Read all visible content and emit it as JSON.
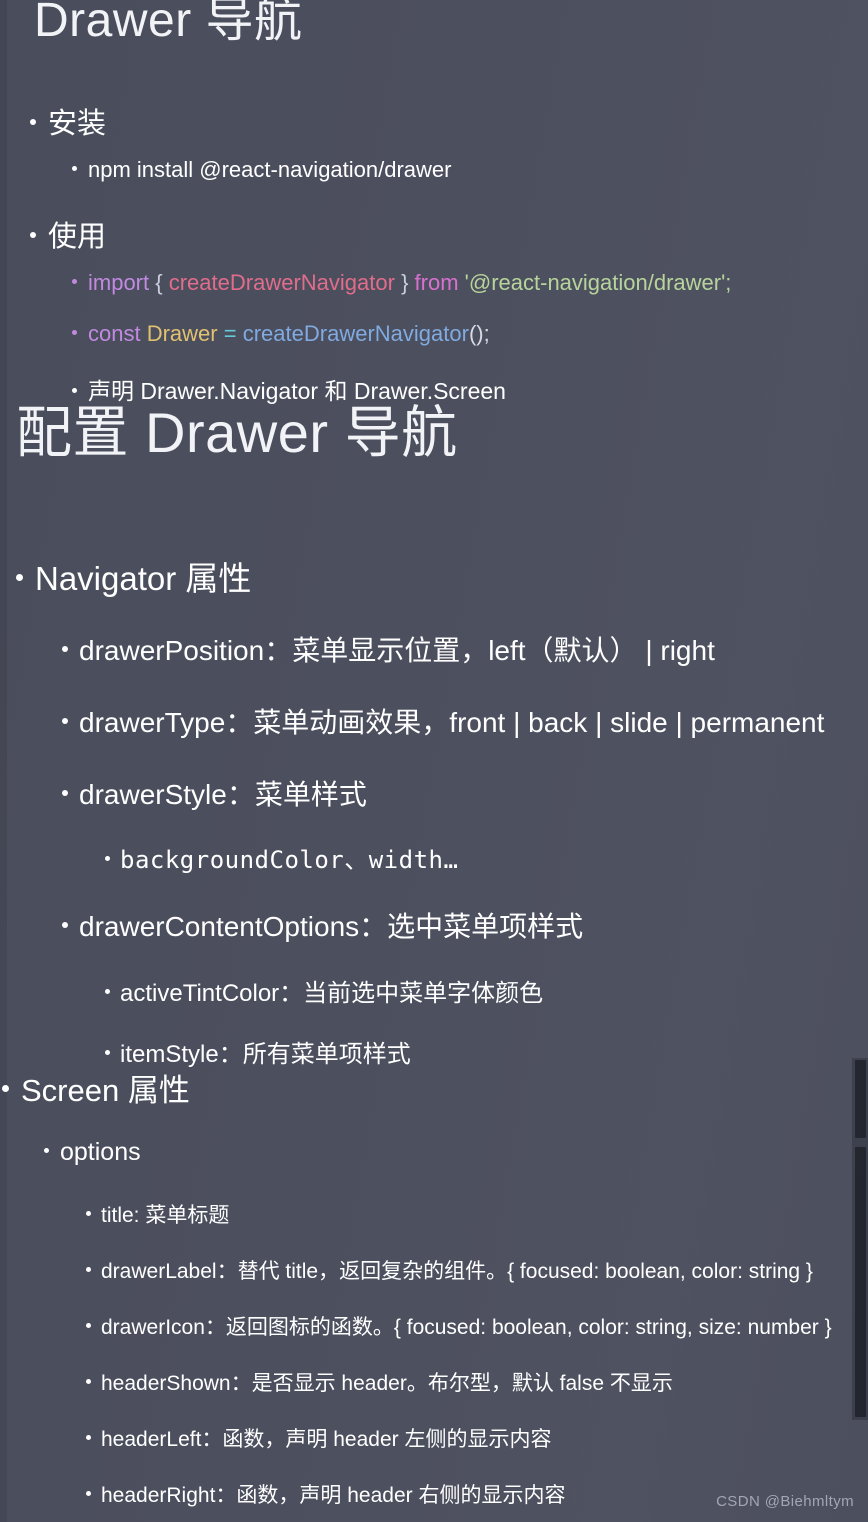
{
  "meta": {
    "background_color": "#4a4d5c",
    "text_color": "#ffffff",
    "watermark": "CSDN @Biehmltym"
  },
  "slide1": {
    "title": "Drawer 导航",
    "bullets": {
      "install_label": "安装",
      "install_cmd": "npm install @react-navigation/drawer",
      "usage_label": "使用",
      "declare_line": "声明 Drawer.Navigator 和 Drawer.Screen"
    },
    "code_import": {
      "kw_import": "import",
      "brace_open": "{",
      "identifier": "createDrawerNavigator",
      "brace_close": "}",
      "kw_from": "from",
      "module_string": "'@react-navigation/drawer';"
    },
    "code_const": {
      "kw_const": "const",
      "var_name": "Drawer",
      "operator": "=",
      "fn_name": "createDrawerNavigator",
      "punct": "();"
    }
  },
  "slide2": {
    "title": "配置 Drawer 导航",
    "navigator": {
      "heading": "Navigator 属性",
      "items": [
        "drawerPosition：菜单显示位置，left（默认） | right",
        "drawerType：菜单动画效果，front | back | slide | permanent",
        "drawerStyle：菜单样式",
        "drawerContentOptions：选中菜单项样式"
      ],
      "drawer_style_sub": "backgroundColor、width…",
      "content_options_subs": [
        "activeTintColor：当前选中菜单字体颜色",
        "itemStyle：所有菜单项样式"
      ]
    },
    "screen": {
      "heading": "Screen 属性",
      "options_label": "options",
      "options": [
        "title: 菜单标题",
        "drawerLabel：替代 title，返回复杂的组件。{ focused: boolean, color: string }",
        "drawerIcon：返回图标的函数。{ focused: boolean, color: string, size: number }",
        "headerShown：是否显示 header。布尔型，默认 false 不显示",
        "headerLeft：函数，声明 header 左侧的显示内容",
        "headerRight：函数，声明 header 右侧的显示内容"
      ]
    }
  },
  "scrollbar": {
    "position": "right"
  }
}
